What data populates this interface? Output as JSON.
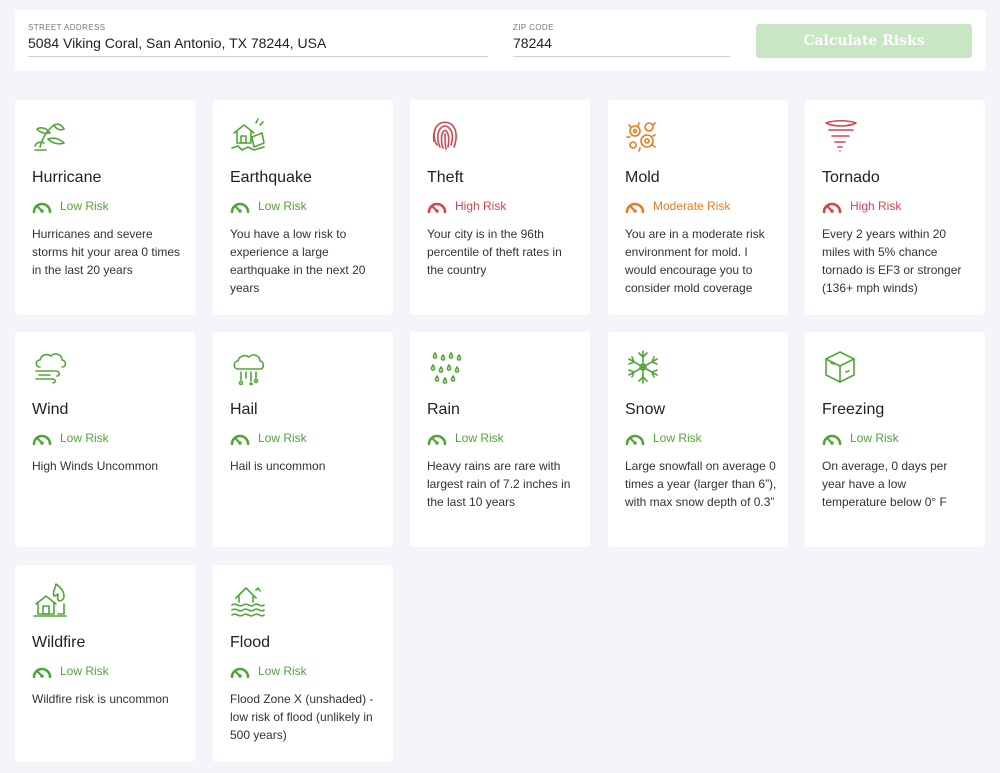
{
  "search": {
    "street_label": "STREET ADDRESS",
    "street_value": "5084 Viking Coral, San Antonio, TX 78244, USA",
    "zip_label": "ZIP CODE",
    "zip_value": "78244",
    "button_label": "Calculate Risks"
  },
  "colors": {
    "low": "#52a639",
    "high": "#d9434c",
    "moderate": "#ef7a1e",
    "button_disabled": "#c9e6c4"
  },
  "cards": [
    {
      "id": "hurricane",
      "icon": "hurricane-icon",
      "title": "Hurricane",
      "risk": "Low Risk",
      "level": "low",
      "desc": "Hurricanes and severe storms hit your area 0 times in the last 20 years"
    },
    {
      "id": "earthquake",
      "icon": "earthquake-icon",
      "title": "Earthquake",
      "risk": "Low Risk",
      "level": "low",
      "desc": "You have a low risk to experience a large earthquake in the next 20 years"
    },
    {
      "id": "theft",
      "icon": "fingerprint-icon",
      "title": "Theft",
      "risk": "High Risk",
      "level": "high",
      "desc": "Your city is in the 96th percentile of theft rates in the country"
    },
    {
      "id": "mold",
      "icon": "mold-icon",
      "title": "Mold",
      "risk": "Moderate Risk",
      "level": "moderate",
      "desc": "You are in a moderate risk environment for mold. I would encourage you to consider mold coverage"
    },
    {
      "id": "tornado",
      "icon": "tornado-icon",
      "title": "Tornado",
      "risk": "High Risk",
      "level": "high",
      "desc": "Every 2 years within 20 miles with 5% chance tornado is EF3 or stronger (136+ mph winds)"
    },
    {
      "id": "wind",
      "icon": "wind-cloud-icon",
      "title": "Wind",
      "risk": "Low Risk",
      "level": "low",
      "desc": "High Winds Uncommon"
    },
    {
      "id": "hail",
      "icon": "hail-cloud-icon",
      "title": "Hail",
      "risk": "Low Risk",
      "level": "low",
      "desc": "Hail is uncommon"
    },
    {
      "id": "rain",
      "icon": "rain-drops-icon",
      "title": "Rain",
      "risk": "Low Risk",
      "level": "low",
      "desc": "Heavy rains are rare with largest rain of 7.2 inches in the last 10 years"
    },
    {
      "id": "snow",
      "icon": "snowflake-icon",
      "title": "Snow",
      "risk": "Low Risk",
      "level": "low",
      "desc": "Large snowfall on average 0 times a year (larger than 6”), with max snow depth of 0.3”"
    },
    {
      "id": "freezing",
      "icon": "ice-cube-icon",
      "title": "Freezing",
      "risk": "Low Risk",
      "level": "low",
      "desc": "On average, 0 days per year have a low temperature below 0° F"
    },
    {
      "id": "wildfire",
      "icon": "wildfire-house-icon",
      "title": "Wildfire",
      "risk": "Low Risk",
      "level": "low",
      "desc": "Wildfire risk is uncommon"
    },
    {
      "id": "flood",
      "icon": "flood-house-icon",
      "title": "Flood",
      "risk": "Low Risk",
      "level": "low",
      "desc": "Flood Zone X (unshaded) - low risk of flood (unlikely in 500 years)"
    }
  ]
}
